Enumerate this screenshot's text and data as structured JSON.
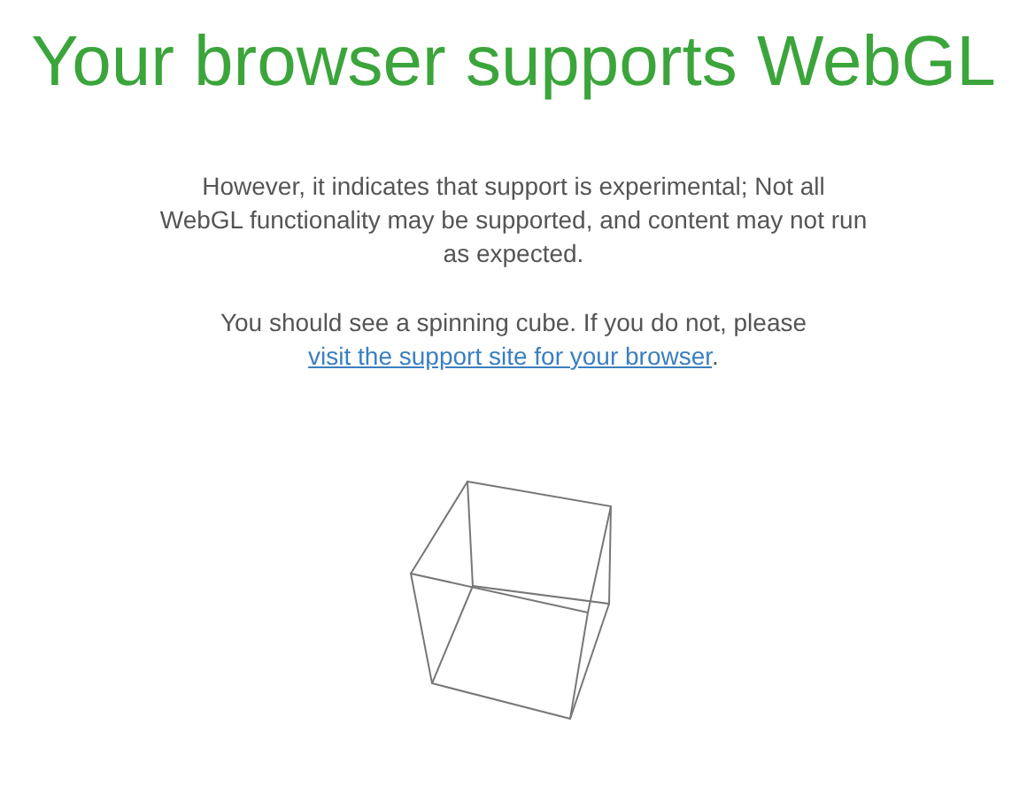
{
  "title": "Your browser supports WebGL",
  "paragraphs": [
    {
      "text": "However, it indicates that support is experimental; Not all WebGL functionality may be supported, and content may not run as expected."
    },
    {
      "text": "You should see a spinning cube. If you do not, please",
      "link": "visit the support site for your browser",
      "after": "."
    }
  ]
}
